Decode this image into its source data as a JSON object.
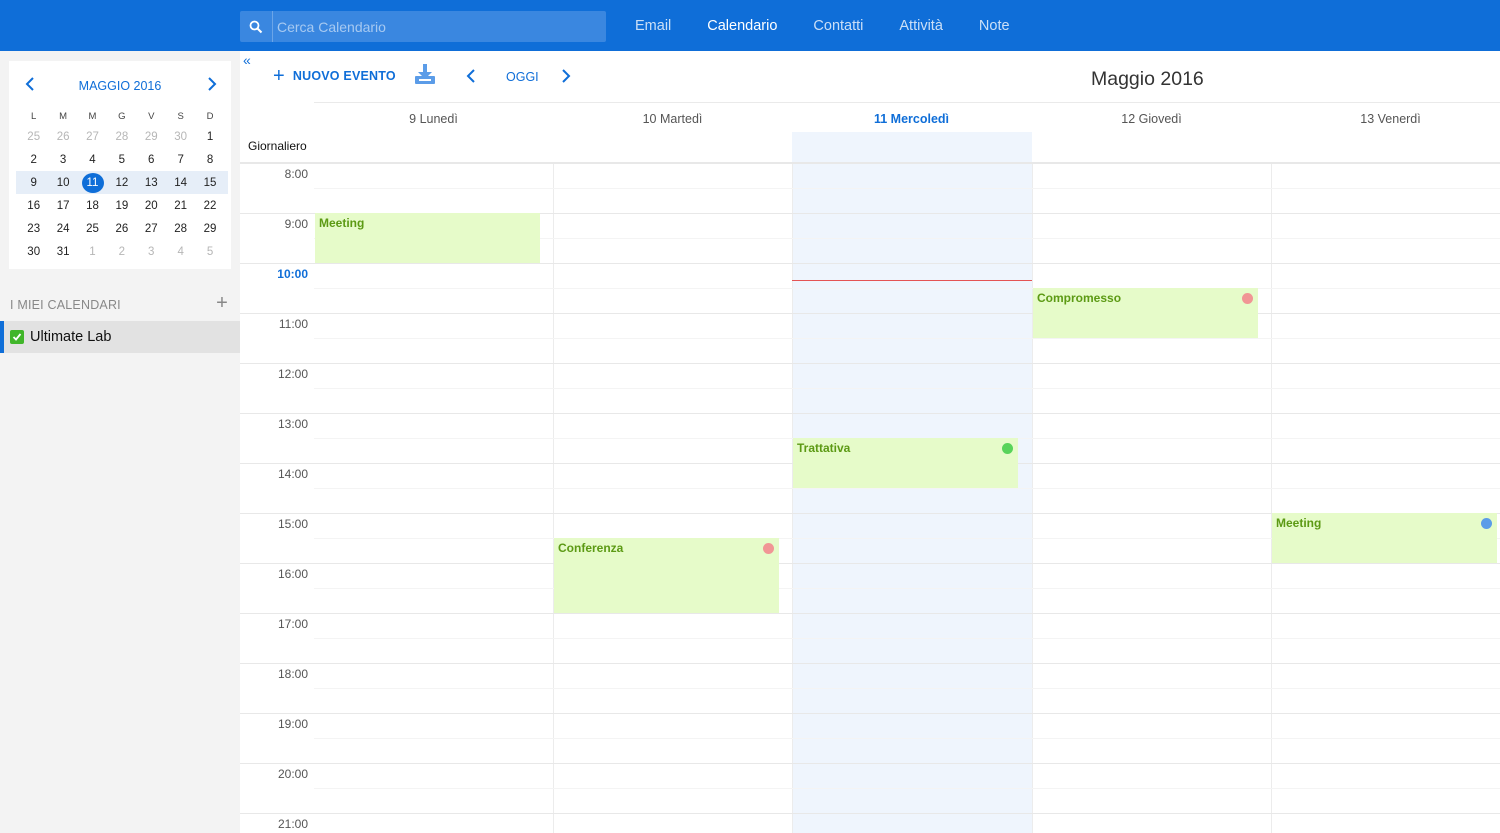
{
  "search": {
    "placeholder": "Cerca Calendario"
  },
  "nav": [
    {
      "label": "Email"
    },
    {
      "label": "Calendario",
      "active": true
    },
    {
      "label": "Contatti"
    },
    {
      "label": "Attività"
    },
    {
      "label": "Note"
    }
  ],
  "minical": {
    "title": "MAGGIO 2016",
    "weekdays": [
      "L",
      "M",
      "M",
      "G",
      "V",
      "S",
      "D"
    ],
    "weeks": [
      [
        {
          "d": "25",
          "m": true
        },
        {
          "d": "26",
          "m": true
        },
        {
          "d": "27",
          "m": true
        },
        {
          "d": "28",
          "m": true
        },
        {
          "d": "29",
          "m": true
        },
        {
          "d": "30",
          "m": true
        },
        {
          "d": "1"
        }
      ],
      [
        {
          "d": "2"
        },
        {
          "d": "3"
        },
        {
          "d": "4"
        },
        {
          "d": "5"
        },
        {
          "d": "6"
        },
        {
          "d": "7"
        },
        {
          "d": "8"
        }
      ],
      [
        {
          "d": "9"
        },
        {
          "d": "10"
        },
        {
          "d": "11",
          "today": true
        },
        {
          "d": "12"
        },
        {
          "d": "13"
        },
        {
          "d": "14"
        },
        {
          "d": "15"
        }
      ],
      [
        {
          "d": "16"
        },
        {
          "d": "17"
        },
        {
          "d": "18"
        },
        {
          "d": "19"
        },
        {
          "d": "20"
        },
        {
          "d": "21"
        },
        {
          "d": "22"
        }
      ],
      [
        {
          "d": "23"
        },
        {
          "d": "24"
        },
        {
          "d": "25"
        },
        {
          "d": "26"
        },
        {
          "d": "27"
        },
        {
          "d": "28"
        },
        {
          "d": "29"
        }
      ],
      [
        {
          "d": "30"
        },
        {
          "d": "31"
        },
        {
          "d": "1",
          "m": true
        },
        {
          "d": "2",
          "m": true
        },
        {
          "d": "3",
          "m": true
        },
        {
          "d": "4",
          "m": true
        },
        {
          "d": "5",
          "m": true
        }
      ]
    ],
    "current_week_index": 2
  },
  "my_calendars": {
    "title": "I MIEI CALENDARI",
    "add_label": "+",
    "items": [
      {
        "label": "Ultimate Lab",
        "checked": true
      }
    ]
  },
  "toolbar": {
    "collapse_label": "«",
    "new_event_plus": "+",
    "new_event_label": "NUOVO EVENTO",
    "today_label": "OGGI",
    "period_title": "Maggio 2016"
  },
  "days": [
    {
      "label": "9 Lunedì"
    },
    {
      "label": "10 Martedì"
    },
    {
      "label": "11 Mercoledì",
      "today": true
    },
    {
      "label": "12 Giovedì"
    },
    {
      "label": "13 Venerdì"
    }
  ],
  "allday_label": "Giornaliero",
  "hours": [
    "8:00",
    "9:00",
    "10:00",
    "11:00",
    "12:00",
    "13:00",
    "14:00",
    "15:00",
    "16:00",
    "17:00",
    "18:00",
    "19:00",
    "20:00",
    "21:00"
  ],
  "current_hour_label": "10:00",
  "now_time": "10:20",
  "events": [
    {
      "title": "Meeting",
      "day": 0,
      "start": "9:00",
      "end": "10:00",
      "dot": null
    },
    {
      "title": "Compromesso",
      "day": 3,
      "start": "10:30",
      "end": "11:30",
      "dot": "#f19595"
    },
    {
      "title": "Trattativa",
      "day": 2,
      "start": "13:30",
      "end": "14:30",
      "dot": "#58d35a"
    },
    {
      "title": "Conferenza",
      "day": 1,
      "start": "15:30",
      "end": "17:00",
      "dot": "#f19595"
    },
    {
      "title": "Meeting",
      "day": 4,
      "start": "15:00",
      "end": "16:00",
      "dot": "#5b9ce8"
    }
  ],
  "colors": {
    "accent": "#0f6ed8",
    "event_bg": "#e6fbc9",
    "event_text": "#5c9a14",
    "now_line": "#e45353",
    "today_bg": "#eff5fd"
  }
}
